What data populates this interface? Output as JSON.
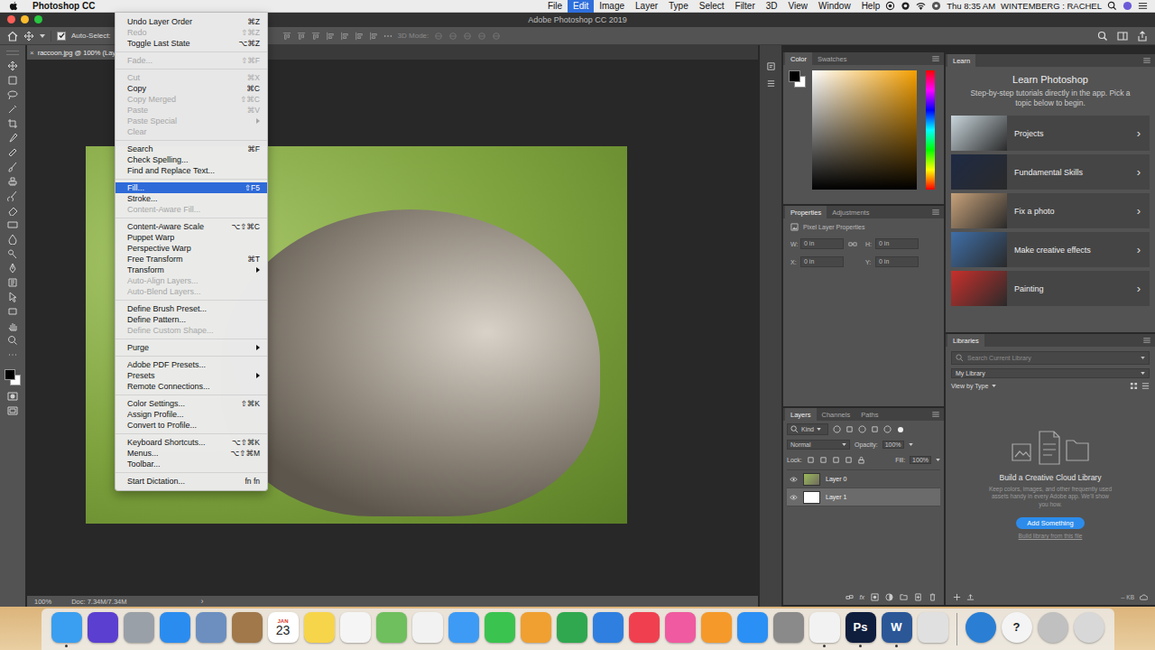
{
  "menubar": {
    "items": [
      {
        "label": "Photoshop CC",
        "kind": "app",
        "selected": false
      },
      {
        "label": "File",
        "kind": "menu",
        "selected": false
      },
      {
        "label": "Edit",
        "kind": "menu",
        "selected": true
      },
      {
        "label": "Image",
        "kind": "menu",
        "selected": false
      },
      {
        "label": "Layer",
        "kind": "menu",
        "selected": false
      },
      {
        "label": "Type",
        "kind": "menu",
        "selected": false
      },
      {
        "label": "Select",
        "kind": "menu",
        "selected": false
      },
      {
        "label": "Filter",
        "kind": "menu",
        "selected": false
      },
      {
        "label": "3D",
        "kind": "menu",
        "selected": false
      },
      {
        "label": "View",
        "kind": "menu",
        "selected": false
      },
      {
        "label": "Window",
        "kind": "menu",
        "selected": false
      },
      {
        "label": "Help",
        "kind": "menu",
        "selected": false
      }
    ],
    "clock": "Thu 8:35 AM",
    "user": "WINTEMBERG : RACHEL"
  },
  "window": {
    "title": "Adobe Photoshop CC 2019"
  },
  "options_bar": {
    "auto_select": {
      "label": "Auto-Select:",
      "checked": true
    },
    "mode_label": "3D Mode:"
  },
  "document": {
    "close": "×",
    "tab": "raccoon.jpg @ 100% (Lay"
  },
  "status_bar": {
    "zoom": "100%",
    "doc": "Doc: 7.34M/7.34M",
    "arrow": "›"
  },
  "edit_menu": {
    "groups": [
      [
        {
          "label": "Undo Layer Order",
          "shortcut": "⌘Z",
          "disabled": false,
          "selected": false,
          "submenu": false
        },
        {
          "label": "Redo",
          "shortcut": "⇧⌘Z",
          "disabled": true,
          "selected": false,
          "submenu": false
        },
        {
          "label": "Toggle Last State",
          "shortcut": "⌥⌘Z",
          "disabled": false,
          "selected": false,
          "submenu": false
        }
      ],
      [
        {
          "label": "Fade...",
          "shortcut": "⇧⌘F",
          "disabled": true,
          "selected": false,
          "submenu": false
        }
      ],
      [
        {
          "label": "Cut",
          "shortcut": "⌘X",
          "disabled": true,
          "selected": false,
          "submenu": false
        },
        {
          "label": "Copy",
          "shortcut": "⌘C",
          "disabled": false,
          "selected": false,
          "submenu": false
        },
        {
          "label": "Copy Merged",
          "shortcut": "⇧⌘C",
          "disabled": true,
          "selected": false,
          "submenu": false
        },
        {
          "label": "Paste",
          "shortcut": "⌘V",
          "disabled": true,
          "selected": false,
          "submenu": false
        },
        {
          "label": "Paste Special",
          "shortcut": "",
          "disabled": true,
          "selected": false,
          "submenu": true
        },
        {
          "label": "Clear",
          "shortcut": "",
          "disabled": true,
          "selected": false,
          "submenu": false
        }
      ],
      [
        {
          "label": "Search",
          "shortcut": "⌘F",
          "disabled": false,
          "selected": false,
          "submenu": false
        },
        {
          "label": "Check Spelling...",
          "shortcut": "",
          "disabled": false,
          "selected": false,
          "submenu": false
        },
        {
          "label": "Find and Replace Text...",
          "shortcut": "",
          "disabled": false,
          "selected": false,
          "submenu": false
        }
      ],
      [
        {
          "label": "Fill...",
          "shortcut": "⇧F5",
          "disabled": false,
          "selected": true,
          "submenu": false
        },
        {
          "label": "Stroke...",
          "shortcut": "",
          "disabled": false,
          "selected": false,
          "submenu": false
        },
        {
          "label": "Content-Aware Fill...",
          "shortcut": "",
          "disabled": true,
          "selected": false,
          "submenu": false
        }
      ],
      [
        {
          "label": "Content-Aware Scale",
          "shortcut": "⌥⇧⌘C",
          "disabled": false,
          "selected": false,
          "submenu": false
        },
        {
          "label": "Puppet Warp",
          "shortcut": "",
          "disabled": false,
          "selected": false,
          "submenu": false
        },
        {
          "label": "Perspective Warp",
          "shortcut": "",
          "disabled": false,
          "selected": false,
          "submenu": false
        },
        {
          "label": "Free Transform",
          "shortcut": "⌘T",
          "disabled": false,
          "selected": false,
          "submenu": false
        },
        {
          "label": "Transform",
          "shortcut": "",
          "disabled": false,
          "selected": false,
          "submenu": true
        },
        {
          "label": "Auto-Align Layers...",
          "shortcut": "",
          "disabled": true,
          "selected": false,
          "submenu": false
        },
        {
          "label": "Auto-Blend Layers...",
          "shortcut": "",
          "disabled": true,
          "selected": false,
          "submenu": false
        }
      ],
      [
        {
          "label": "Define Brush Preset...",
          "shortcut": "",
          "disabled": false,
          "selected": false,
          "submenu": false
        },
        {
          "label": "Define Pattern...",
          "shortcut": "",
          "disabled": false,
          "selected": false,
          "submenu": false
        },
        {
          "label": "Define Custom Shape...",
          "shortcut": "",
          "disabled": true,
          "selected": false,
          "submenu": false
        }
      ],
      [
        {
          "label": "Purge",
          "shortcut": "",
          "disabled": false,
          "selected": false,
          "submenu": true
        }
      ],
      [
        {
          "label": "Adobe PDF Presets...",
          "shortcut": "",
          "disabled": false,
          "selected": false,
          "submenu": false
        },
        {
          "label": "Presets",
          "shortcut": "",
          "disabled": false,
          "selected": false,
          "submenu": true
        },
        {
          "label": "Remote Connections...",
          "shortcut": "",
          "disabled": false,
          "selected": false,
          "submenu": false
        }
      ],
      [
        {
          "label": "Color Settings...",
          "shortcut": "⇧⌘K",
          "disabled": false,
          "selected": false,
          "submenu": false
        },
        {
          "label": "Assign Profile...",
          "shortcut": "",
          "disabled": false,
          "selected": false,
          "submenu": false
        },
        {
          "label": "Convert to Profile...",
          "shortcut": "",
          "disabled": false,
          "selected": false,
          "submenu": false
        }
      ],
      [
        {
          "label": "Keyboard Shortcuts...",
          "shortcut": "⌥⇧⌘K",
          "disabled": false,
          "selected": false,
          "submenu": false
        },
        {
          "label": "Menus...",
          "shortcut": "⌥⇧⌘M",
          "disabled": false,
          "selected": false,
          "submenu": false
        },
        {
          "label": "Toolbar...",
          "shortcut": "",
          "disabled": false,
          "selected": false,
          "submenu": false
        }
      ],
      [
        {
          "label": "Start Dictation...",
          "shortcut": "fn fn",
          "disabled": false,
          "selected": false,
          "submenu": false
        }
      ]
    ]
  },
  "color_panel": {
    "tabs": [
      {
        "label": "Color",
        "selected": true
      },
      {
        "label": "Swatches",
        "selected": false
      }
    ],
    "foreground_color": "#000000",
    "background_color": "#ffffff",
    "hue_color": "#f5a000"
  },
  "properties_panel": {
    "tabs": [
      {
        "label": "Properties",
        "selected": true
      },
      {
        "label": "Adjustments",
        "selected": false
      }
    ],
    "title": "Pixel Layer Properties",
    "fields": [
      {
        "label": "W:",
        "value": "0 in"
      },
      {
        "label": "H:",
        "value": "0 in"
      },
      {
        "label": "X:",
        "value": "0 in"
      },
      {
        "label": "Y:",
        "value": "0 in"
      }
    ]
  },
  "layers_panel": {
    "tabs": [
      {
        "label": "Layers",
        "selected": true
      },
      {
        "label": "Channels",
        "selected": false
      },
      {
        "label": "Paths",
        "selected": false
      }
    ],
    "filter": "Kind",
    "blend": "Normal",
    "opacity_label": "Opacity:",
    "opacity": "100%",
    "lock_label": "Lock:",
    "fill_label": "Fill:",
    "fill": "100%",
    "fx": "fx",
    "layers": [
      {
        "name": "Layer 0",
        "visible": true,
        "selected": false,
        "kind": "photo"
      },
      {
        "name": "Layer 1",
        "visible": true,
        "selected": true,
        "kind": "blank"
      }
    ]
  },
  "learn_panel": {
    "title": "Learn",
    "heading": "Learn Photoshop",
    "intro": "Step-by-step tutorials directly in the app. Pick a topic below to begin.",
    "chevron": "›",
    "topics": [
      {
        "label": "Projects",
        "color": "#c9d6dc"
      },
      {
        "label": "Fundamental Skills",
        "color": "#1e2a44"
      },
      {
        "label": "Fix a photo",
        "color": "#c8a27a"
      },
      {
        "label": "Make creative effects",
        "color": "#3f6fa8"
      },
      {
        "label": "Painting",
        "color": "#c8302c"
      }
    ]
  },
  "libraries_panel": {
    "title": "Libraries",
    "search_placeholder": "Search Current Library",
    "library": "My Library",
    "view": "View by Type",
    "heading": "Build a Creative Cloud Library",
    "body": "Keep colors, images, and other frequently used assets handy in every Adobe app. We'll show you how.",
    "button": "Add Something",
    "link": "Build library from this file",
    "size": "-- KB"
  },
  "dock": {
    "apps": [
      {
        "top": "",
        "label": "",
        "color": "#3a9ff0",
        "running": true
      },
      {
        "top": "",
        "label": "",
        "color": "#5b3fd0",
        "running": false
      },
      {
        "top": "",
        "label": "",
        "color": "#9aa0a8",
        "running": false
      },
      {
        "top": "",
        "label": "",
        "color": "#2b8cf0",
        "running": false
      },
      {
        "top": "",
        "label": "",
        "color": "#6c8fc0",
        "running": false
      },
      {
        "top": "",
        "label": "",
        "color": "#a0784a",
        "running": false
      },
      {
        "top": "JAN",
        "label": "23",
        "color": "#ffffff",
        "running": false
      },
      {
        "top": "",
        "label": "",
        "color": "#f7d54a",
        "running": false
      },
      {
        "top": "",
        "label": "",
        "color": "#f5f5f5",
        "running": false
      },
      {
        "top": "",
        "label": "",
        "color": "#6fbf5e",
        "running": false
      },
      {
        "top": "",
        "label": "",
        "color": "#f2f2f2",
        "running": false
      },
      {
        "top": "",
        "label": "",
        "color": "#3d9bf5",
        "running": false
      },
      {
        "top": "",
        "label": "",
        "color": "#3ac34f",
        "running": false
      },
      {
        "top": "",
        "label": "",
        "color": "#f0a030",
        "running": false
      },
      {
        "top": "",
        "label": "",
        "color": "#2fa84f",
        "running": false
      },
      {
        "top": "",
        "label": "",
        "color": "#2f7fe0",
        "running": false
      },
      {
        "top": "",
        "label": "",
        "color": "#f04050",
        "running": false
      },
      {
        "top": "",
        "label": "",
        "color": "#f05aa0",
        "running": false
      },
      {
        "top": "",
        "label": "",
        "color": "#f59a2a",
        "running": false
      },
      {
        "top": "",
        "label": "",
        "color": "#2b90f5",
        "running": false
      },
      {
        "top": "",
        "label": "",
        "color": "#8a8a8a",
        "running": false
      },
      {
        "top": "",
        "label": "",
        "color": "#f2f2f2",
        "running": true
      },
      {
        "top": "",
        "label": "Ps",
        "color": "#0f1e3d",
        "running": true
      },
      {
        "top": "",
        "label": "W",
        "color": "#2b5797",
        "running": true
      },
      {
        "top": "",
        "label": "",
        "color": "#e0e0e0",
        "running": false
      }
    ],
    "others": [
      {
        "top": "",
        "label": "",
        "color": "#2a7fd4",
        "running": false
      },
      {
        "top": "",
        "label": "?",
        "color": "#f4f4f4",
        "running": false
      },
      {
        "top": "",
        "label": "",
        "color": "#c0c0c0",
        "running": false
      },
      {
        "top": "",
        "label": "",
        "color": "#d8d8d8",
        "running": false
      }
    ]
  }
}
